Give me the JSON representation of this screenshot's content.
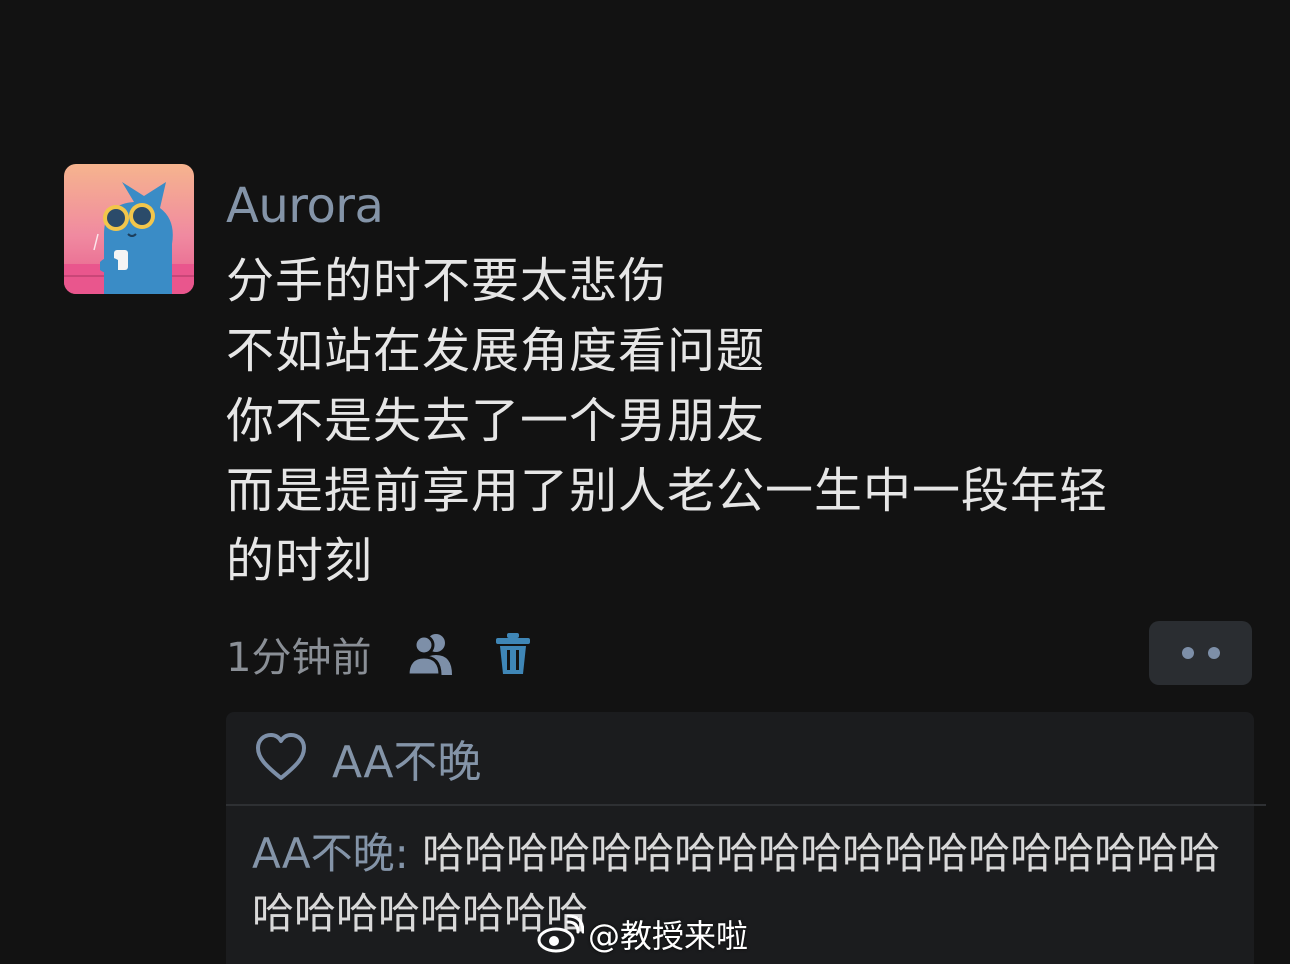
{
  "post": {
    "username": "Aurora",
    "message_lines": [
      "分手的时不要太悲伤",
      "不如站在发展角度看问题",
      "你不是失去了一个男朋友",
      "而是提前享用了别人老公一生中一段年轻",
      "的时刻"
    ],
    "timestamp": "1分钟前",
    "icons": {
      "avatar": "cat-with-sunglasses-avatar",
      "visibility": "users-icon",
      "delete": "trash-icon",
      "more": "more-dots-icon",
      "like": "heart-icon",
      "watermark_logo": "weibo-logo"
    }
  },
  "reactions": {
    "likers": "AA不晚"
  },
  "comments": [
    {
      "author": "AA不晚:",
      "text": "哈哈哈哈哈哈哈哈哈哈哈哈哈哈哈哈哈哈哈哈哈哈哈哈哈哈哈"
    }
  ],
  "watermark": {
    "text": "@教授来啦"
  },
  "colors": {
    "background": "#121212",
    "username": "#8494a8",
    "message": "#e6e6e6",
    "meta": "#8a8f96",
    "panel": "#1b1c1e",
    "accent_blue": "#3f86b6"
  }
}
